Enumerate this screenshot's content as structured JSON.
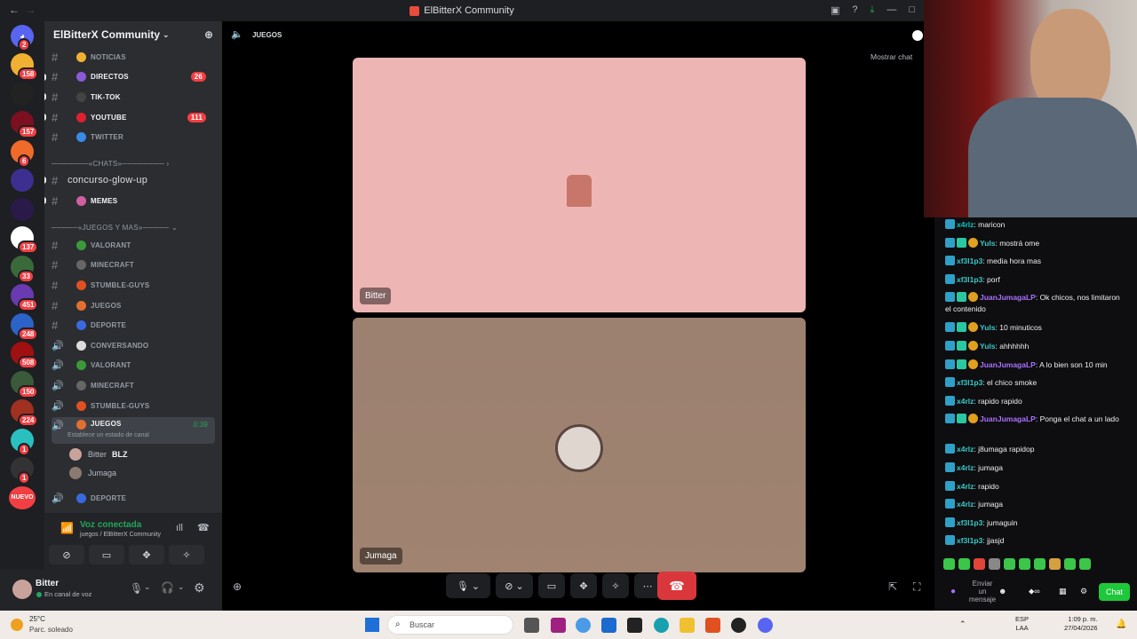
{
  "window": {
    "title": "ElBitterX Community"
  },
  "guild": {
    "name": "ElBitterX Community"
  },
  "servers": [
    {
      "badge": "2",
      "color": "#5865f2"
    },
    {
      "badge": "158",
      "color": "#f0b132"
    },
    {
      "badge": "",
      "color": "#222"
    },
    {
      "badge": "157",
      "color": "#7a1020"
    },
    {
      "badge": "6",
      "color": "#f06a2a"
    },
    {
      "badge": "",
      "color": "#3c2f8f"
    },
    {
      "badge": "",
      "color": "#2a1a4a"
    },
    {
      "badge": "137",
      "color": "#ffffff"
    },
    {
      "badge": "33",
      "color": "#3a6a3a"
    },
    {
      "badge": "451",
      "color": "#6a3ab0"
    },
    {
      "badge": "248",
      "color": "#2b63c8"
    },
    {
      "badge": "508",
      "color": "#a01010"
    },
    {
      "badge": "150",
      "color": "#3a5a3a"
    },
    {
      "badge": "224",
      "color": "#a03020"
    },
    {
      "badge": "1",
      "color": "#2ac0c0"
    },
    {
      "badge": "1",
      "color": "#333"
    },
    {
      "badge": "NUEVO",
      "color": "#f23f43"
    }
  ],
  "channels": [
    {
      "name": "NOTICIAS",
      "count": "",
      "emoji": "#f0b132",
      "unread": false
    },
    {
      "name": "DIRECTOS",
      "count": "26",
      "emoji": "#8a5ad8",
      "unread": true
    },
    {
      "name": "TIK-TOK",
      "count": "",
      "emoji": "#444",
      "unread": true
    },
    {
      "name": "YOUTUBE",
      "count": "111",
      "emoji": "#e02030",
      "unread": true
    },
    {
      "name": "TWITTER",
      "count": "",
      "emoji": "#3a8ae8",
      "unread": false
    }
  ],
  "cat_chats": "───────«CHATS»──────── ›",
  "concurso": "concurso-glow-up",
  "memes": "MEMES",
  "cat_juegos": "─────«JUEGOS Y MAS»───── ⌄",
  "text_games": [
    "VALORANT",
    "MINECRAFT",
    "STUMBLE-GUYS",
    "JUEGOS",
    "DEPORTE"
  ],
  "voice_channels": [
    "CONVERSANDO",
    "VALORANT",
    "MINECRAFT",
    "STUMBLE-GUYS"
  ],
  "active_voice": {
    "name": "JUEGOS",
    "time": "0:39",
    "status": "Establece un estado de canal"
  },
  "voice_users": [
    {
      "name": "Bitter",
      "tag": "BLZ"
    },
    {
      "name": "Jumaga",
      "tag": ""
    }
  ],
  "last_voice": "DEPORTE",
  "voice_connected": {
    "title": "Voz conectada",
    "sub": "juegos / ElBitterX Community"
  },
  "user": {
    "name": "Bitter",
    "status": "En canal de voz"
  },
  "stage": {
    "channel": "JUEGOS",
    "show_chat": "Mostrar chat",
    "tile1": "Bitter",
    "tile2": "Jumaga"
  },
  "chat": [
    {
      "user": "x4rlz",
      "text": "maricon",
      "color": "#00c8c8",
      "mod": false
    },
    {
      "user": "Yuls",
      "text": "mostrá ome",
      "color": "#39c8c8",
      "mod": true
    },
    {
      "user": "xf3l1p3",
      "text": "media hora mas",
      "color": "#39c8c8",
      "mod": false
    },
    {
      "user": "xf3l1p3",
      "text": "porf",
      "color": "#39c8c8",
      "mod": false
    },
    {
      "user": "JuanJumagaLP",
      "text": "Ok chicos, nos limitaron el contenido",
      "color": "#a970ff",
      "mod": true
    },
    {
      "user": "Yuls",
      "text": "10 minuticos",
      "color": "#39c8c8",
      "mod": true
    },
    {
      "user": "Yuls",
      "text": "ahhhhhh",
      "color": "#39c8c8",
      "mod": true
    },
    {
      "user": "JuanJumagaLP",
      "text": "A lo bien son 10 min",
      "color": "#a970ff",
      "mod": true
    },
    {
      "user": "xf3l1p3",
      "text": "el chico smoke",
      "color": "#39c8c8",
      "mod": false
    },
    {
      "user": "x4rlz",
      "text": "rapido rapido",
      "color": "#39c8c8",
      "mod": false
    },
    {
      "user": "JuanJumagaLP",
      "text": "Ponga el chat a un lado",
      "color": "#a970ff",
      "mod": true
    },
    {
      "user": "x4rlz",
      "text": "j8umaga rapidop",
      "color": "#39c8c8",
      "mod": false
    },
    {
      "user": "x4rlz",
      "text": "jumaga",
      "color": "#39c8c8",
      "mod": false
    },
    {
      "user": "x4rlz",
      "text": "rapido",
      "color": "#39c8c8",
      "mod": false
    },
    {
      "user": "x4rlz",
      "text": "jumaga",
      "color": "#39c8c8",
      "mod": false
    },
    {
      "user": "xf3l1p3",
      "text": "jumaguin",
      "color": "#39c8c8",
      "mod": false
    },
    {
      "user": "xf3l1p3",
      "text": "jjasjd",
      "color": "#39c8c8",
      "mod": false
    }
  ],
  "chat_input": {
    "placeholder": "Enviar un mensaje",
    "button": "Chat"
  },
  "taskbar": {
    "temp": "25°C",
    "weather": "Parc. soleado",
    "search": "Buscar",
    "lang": "ESP",
    "lang2": "LAA",
    "time": "1:09 p. m.",
    "date": "27/04/2026"
  }
}
